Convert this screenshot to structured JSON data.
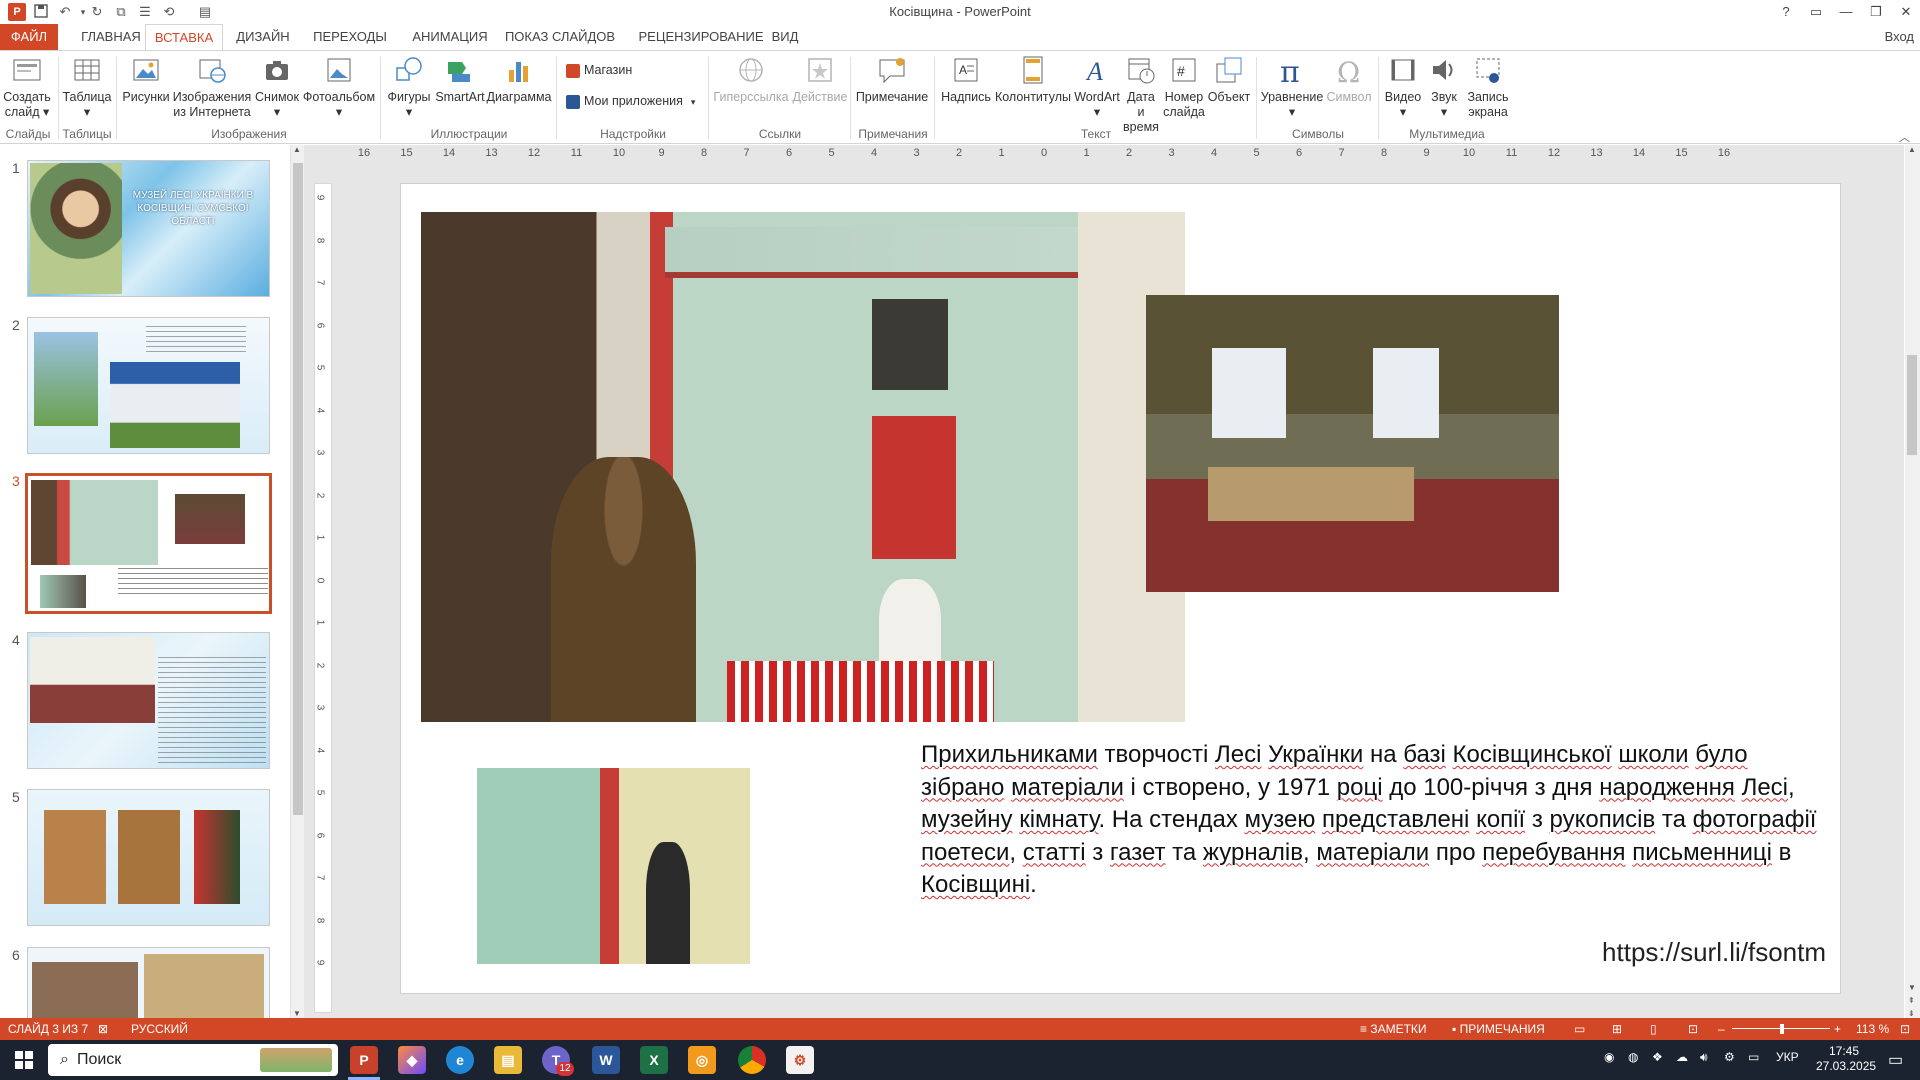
{
  "window": {
    "title": "Косівщина - PowerPoint",
    "help": "?",
    "restore_ribbon": "▭",
    "minimize": "—",
    "maximize": "❐",
    "close": "✕"
  },
  "tabs": [
    {
      "label": "ФАЙЛ"
    },
    {
      "label": "ГЛАВНАЯ"
    },
    {
      "label": "ВСТАВКА"
    },
    {
      "label": "ДИЗАЙН"
    },
    {
      "label": "ПЕРЕХОДЫ"
    },
    {
      "label": "АНИМАЦИЯ"
    },
    {
      "label": "ПОКАЗ СЛАЙДОВ"
    },
    {
      "label": "РЕЦЕНЗИРОВАНИЕ"
    },
    {
      "label": "ВИД"
    }
  ],
  "sign_in": "Вход",
  "ribbon": {
    "new_slide": {
      "line1": "Создать",
      "line2": "слайд ▾"
    },
    "table": {
      "line1": "Таблица",
      "line2": "▾"
    },
    "pictures": "Рисунки",
    "online_pictures": {
      "line1": "Изображения",
      "line2": "из Интернета"
    },
    "screenshot": {
      "line1": "Снимок",
      "line2": "▾"
    },
    "photo_album": {
      "line1": "Фотоальбом",
      "line2": "▾"
    },
    "shapes": {
      "line1": "Фигуры",
      "line2": "▾"
    },
    "smartart": "SmartArt",
    "chart": "Диаграмма",
    "store": "Магазин",
    "my_apps": "Мои приложения",
    "hyperlink": "Гиперссылка",
    "action": "Действие",
    "comment": "Примечание",
    "textbox": "Надпись",
    "header_footer": "Колонтитулы",
    "wordart": {
      "line1": "WordArt",
      "line2": "▾"
    },
    "date_time": {
      "line1": "Дата и",
      "line2": "время"
    },
    "slide_number": {
      "line1": "Номер",
      "line2": "слайда"
    },
    "object": "Объект",
    "equation": {
      "line1": "Уравнение",
      "line2": "▾"
    },
    "symbol": "Символ",
    "video": {
      "line1": "Видео",
      "line2": "▾"
    },
    "audio": {
      "line1": "Звук",
      "line2": "▾"
    },
    "screen_recording": {
      "line1": "Запись",
      "line2": "экрана"
    },
    "groups": {
      "slides": "Слайды",
      "tables": "Таблицы",
      "images": "Изображения",
      "illustrations": "Иллюстрации",
      "addins": "Надстройки",
      "links": "Ссылки",
      "comments": "Примечания",
      "text": "Текст",
      "symbols": "Символы",
      "media": "Мультимедиа"
    }
  },
  "thumbnails": [
    {
      "number": "1",
      "title": "МУЗЕЙ ЛЕСІ УКРАЇНКИ В КОСІВЩИНІ СУМСЬКОЇ ОБЛАСТІ"
    },
    {
      "number": "2"
    },
    {
      "number": "3"
    },
    {
      "number": "4"
    },
    {
      "number": "5"
    },
    {
      "number": "6"
    }
  ],
  "ruler_ticks": [
    "16",
    "15",
    "14",
    "13",
    "12",
    "11",
    "10",
    "9",
    "8",
    "7",
    "6",
    "5",
    "4",
    "3",
    "2",
    "1",
    "0",
    "1",
    "2",
    "3",
    "4",
    "5",
    "6",
    "7",
    "8",
    "9",
    "10",
    "11",
    "12",
    "13",
    "14",
    "15",
    "16"
  ],
  "vruler_ticks": [
    "9",
    "8",
    "7",
    "6",
    "5",
    "4",
    "3",
    "2",
    "1",
    "0",
    "1",
    "2",
    "3",
    "4",
    "5",
    "6",
    "7",
    "8",
    "9"
  ],
  "slide": {
    "body_words": [
      {
        "t": "Прихильниками",
        "err": true
      },
      {
        "t": " творчості ",
        "err": false
      },
      {
        "t": "Лесі",
        "err": true
      },
      {
        "t": " ",
        "err": false
      },
      {
        "t": "Українки",
        "err": true
      },
      {
        "t": " на ",
        "err": false
      },
      {
        "t": "базі",
        "err": true
      },
      {
        "t": " ",
        "err": false
      },
      {
        "t": "Косівщинської",
        "err": true
      },
      {
        "t": " ",
        "err": false
      },
      {
        "t": "школи",
        "err": true
      },
      {
        "t": " ",
        "err": false
      },
      {
        "t": "було",
        "err": true
      },
      {
        "t": " ",
        "err": false
      },
      {
        "t": "зібрано",
        "err": true
      },
      {
        "t": " ",
        "err": false
      },
      {
        "t": "матеріали",
        "err": true
      },
      {
        "t": " і створено, у 1971 ",
        "err": false
      },
      {
        "t": "році",
        "err": true
      },
      {
        "t": " до 100-річчя з дня ",
        "err": false
      },
      {
        "t": "народження",
        "err": true
      },
      {
        "t": " ",
        "err": false
      },
      {
        "t": "Лесі",
        "err": true
      },
      {
        "t": ", ",
        "err": false
      },
      {
        "t": "музейну",
        "err": true
      },
      {
        "t": " ",
        "err": false
      },
      {
        "t": "кімнату",
        "err": true
      },
      {
        "t": ". На стендах ",
        "err": false
      },
      {
        "t": "музею",
        "err": true
      },
      {
        "t": " ",
        "err": false
      },
      {
        "t": "представлені",
        "err": true
      },
      {
        "t": " ",
        "err": false
      },
      {
        "t": "копії",
        "err": true
      },
      {
        "t": " з ",
        "err": false
      },
      {
        "t": "рукописів",
        "err": true
      },
      {
        "t": " та ",
        "err": false
      },
      {
        "t": "фотографії",
        "err": true
      },
      {
        "t": " ",
        "err": false
      },
      {
        "t": "поетеси",
        "err": true
      },
      {
        "t": ", ",
        "err": false
      },
      {
        "t": "статті",
        "err": true
      },
      {
        "t": " з ",
        "err": false
      },
      {
        "t": "газет",
        "err": true
      },
      {
        "t": " та ",
        "err": false
      },
      {
        "t": "журналів",
        "err": true
      },
      {
        "t": ", ",
        "err": false
      },
      {
        "t": "матеріали",
        "err": true
      },
      {
        "t": " про ",
        "err": false
      },
      {
        "t": "перебування",
        "err": true
      },
      {
        "t": " ",
        "err": false
      },
      {
        "t": "письменниці",
        "err": true
      },
      {
        "t": " в ",
        "err": false
      },
      {
        "t": "Косівщині",
        "err": true
      },
      {
        "t": ".",
        "err": false
      }
    ],
    "source_link": "https://surl.li/fsontm"
  },
  "status": {
    "slide_counter": "СЛАЙД 3 ИЗ 7",
    "language": "РУССКИЙ",
    "notes": "ЗАМЕТКИ",
    "comments": "ПРИМЕЧАНИЯ",
    "zoom": "113 %"
  },
  "taskbar": {
    "search_placeholder": "Поиск",
    "language": "УКР",
    "time": "17:45",
    "date": "27.03.2025",
    "teams_badge": "12"
  },
  "colors": {
    "accent": "#d24726",
    "taskbar": "#1b2230"
  }
}
